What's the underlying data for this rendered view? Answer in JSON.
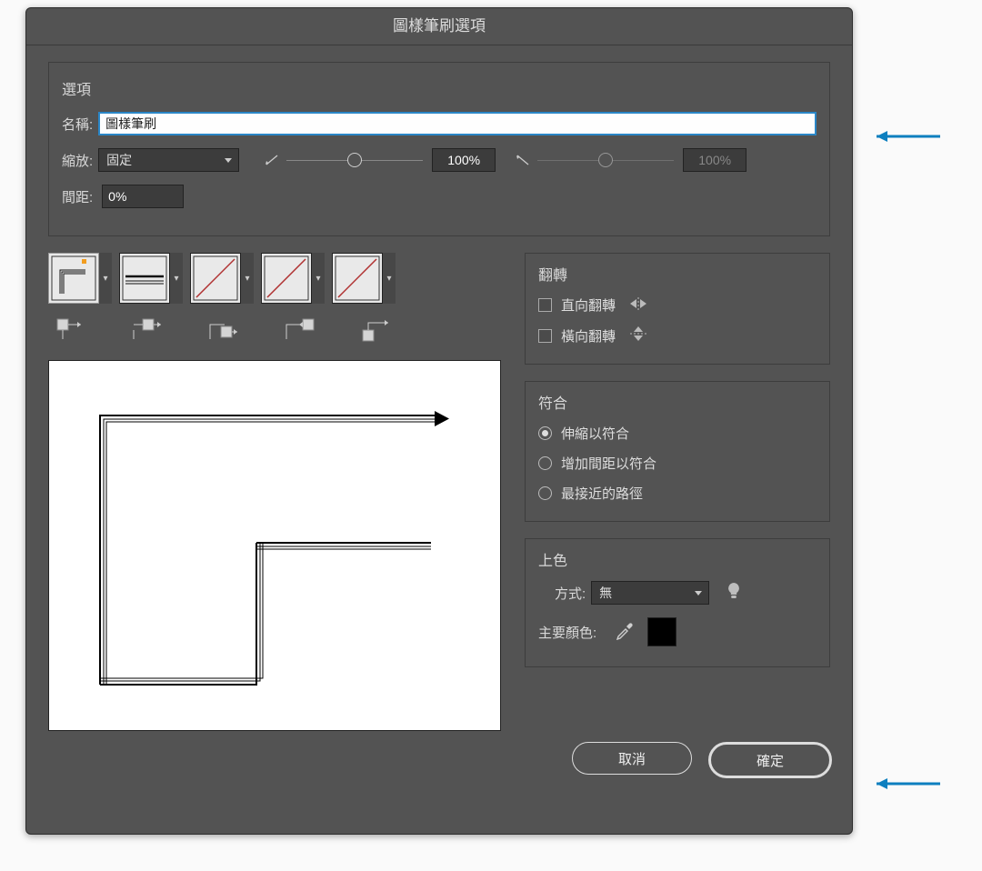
{
  "dialog": {
    "title": "圖樣筆刷選項"
  },
  "options": {
    "section_label": "選項",
    "name_label": "名稱:",
    "name_value": "圖樣筆刷",
    "scale_label": "縮放:",
    "scale_mode": "固定",
    "scale_value": "100%",
    "scale_value2": "100%",
    "spacing_label": "間距:",
    "spacing_value": "0%"
  },
  "flip": {
    "section_label": "翻轉",
    "across_label": "直向翻轉",
    "along_label": "橫向翻轉",
    "across_checked": false,
    "along_checked": false
  },
  "fit": {
    "section_label": "符合",
    "options": [
      "伸縮以符合",
      "增加間距以符合",
      "最接近的路徑"
    ],
    "selected_index": 0
  },
  "colorize": {
    "section_label": "上色",
    "method_label": "方式:",
    "method_value": "無",
    "key_color_label": "主要顏色:",
    "key_color_hex": "#000000"
  },
  "footer": {
    "cancel": "取消",
    "ok": "確定"
  },
  "tiles": {
    "names": [
      "outer-corner",
      "side",
      "inner-corner",
      "start",
      "end"
    ]
  }
}
